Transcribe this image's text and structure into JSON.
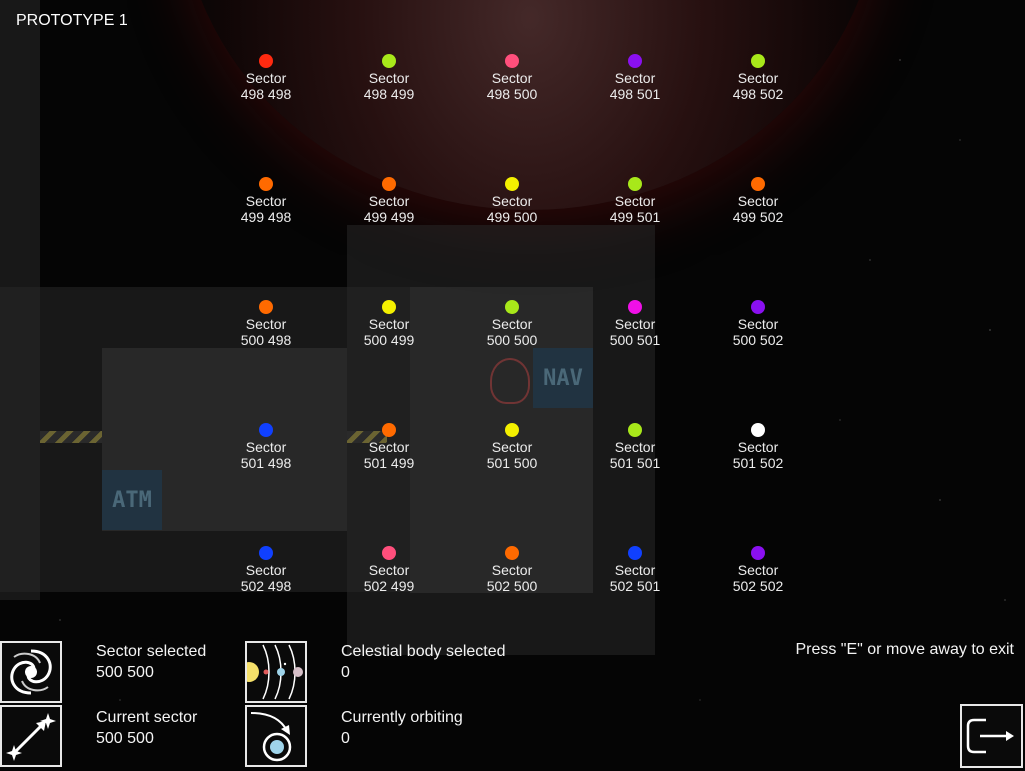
{
  "title": "PROTOTYPE 1",
  "sectors": [
    {
      "word": "Sector",
      "coords": "498 498",
      "color": "#ff2a10"
    },
    {
      "word": "Sector",
      "coords": "498 499",
      "color": "#a8e81a"
    },
    {
      "word": "Sector",
      "coords": "498 500",
      "color": "#ff4f7c"
    },
    {
      "word": "Sector",
      "coords": "498 501",
      "color": "#8a10f0"
    },
    {
      "word": "Sector",
      "coords": "498 502",
      "color": "#a8e81a"
    },
    {
      "word": "Sector",
      "coords": "499 498",
      "color": "#ff6a00"
    },
    {
      "word": "Sector",
      "coords": "499 499",
      "color": "#ff6a00"
    },
    {
      "word": "Sector",
      "coords": "499 500",
      "color": "#f4f000"
    },
    {
      "word": "Sector",
      "coords": "499 501",
      "color": "#a8e81a"
    },
    {
      "word": "Sector",
      "coords": "499 502",
      "color": "#ff6a00"
    },
    {
      "word": "Sector",
      "coords": "500 498",
      "color": "#ff6a00"
    },
    {
      "word": "Sector",
      "coords": "500 499",
      "color": "#f4f000"
    },
    {
      "word": "Sector",
      "coords": "500 500",
      "color": "#a8e81a"
    },
    {
      "word": "Sector",
      "coords": "500 501",
      "color": "#f010e8"
    },
    {
      "word": "Sector",
      "coords": "500 502",
      "color": "#8a10f0"
    },
    {
      "word": "Sector",
      "coords": "501 498",
      "color": "#1040ff"
    },
    {
      "word": "Sector",
      "coords": "501 499",
      "color": "#ff6a00"
    },
    {
      "word": "Sector",
      "coords": "501 500",
      "color": "#f4f000"
    },
    {
      "word": "Sector",
      "coords": "501 501",
      "color": "#a8e81a"
    },
    {
      "word": "Sector",
      "coords": "501 502",
      "color": "#ffffff"
    },
    {
      "word": "Sector",
      "coords": "502 498",
      "color": "#1040ff"
    },
    {
      "word": "Sector",
      "coords": "502 499",
      "color": "#ff4f7c"
    },
    {
      "word": "Sector",
      "coords": "502 500",
      "color": "#ff6a00"
    },
    {
      "word": "Sector",
      "coords": "502 501",
      "color": "#1040ff"
    },
    {
      "word": "Sector",
      "coords": "502 502",
      "color": "#8a10f0"
    }
  ],
  "ship_signs": {
    "nav": "NAV",
    "atm": "ATM"
  },
  "hud": {
    "sector_selected": {
      "label": "Sector selected",
      "value": "500 500",
      "icon": "galaxy-icon"
    },
    "current_sector": {
      "label": "Current sector",
      "value": "500 500",
      "icon": "warp-icon"
    },
    "celestial_selected": {
      "label": "Celestial body selected",
      "value": "0",
      "icon": "solar-system-icon"
    },
    "currently_orbiting": {
      "label": "Currently orbiting",
      "value": "0",
      "icon": "orbit-icon"
    },
    "hint": "Press \"E\" or move away to exit",
    "exit_icon": "exit-icon"
  },
  "colors": {
    "background": "#050505",
    "text": "#f2f2f2",
    "frame": "#e8e8e8"
  }
}
